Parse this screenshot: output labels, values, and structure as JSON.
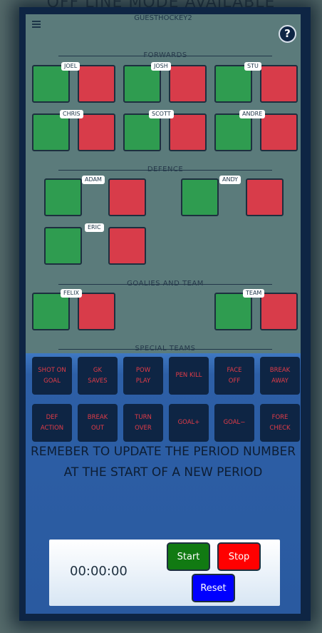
{
  "banner": "OFF LINE MODE AVAILABLE",
  "header": {
    "title": "GUESTHOCKEY2",
    "help_label": "?"
  },
  "sections": {
    "forwards": "FORWARDS",
    "defence": "DEFENCE",
    "goalies_team": "GOALIES AND TEAM",
    "special_teams": "SPECIAL TEAMS"
  },
  "players": {
    "forwards": [
      "JOEL",
      "JOSH",
      "STU",
      "CHRIS",
      "SCOTT",
      "ANDRE"
    ],
    "defence": [
      "ADAM",
      "ANDY",
      "ERIC"
    ],
    "goalies_team": [
      "FELIX",
      "TEAM"
    ]
  },
  "special_teams": [
    "SHOT ON\nGOAL",
    "GK\nSAVES",
    "POW\nPLAY",
    "PEN KILL",
    "FACE\nOFF",
    "BREAK\nAWAY",
    "DEF\nACTION",
    "BREAK\nOUT",
    "TURN\nOVER",
    "GOAL+",
    "GOAL−",
    "FORE\nCHECK"
  ],
  "reminder": "REMEBER TO UPDATE THE PERIOD NUMBER AT THE START OF A NEW PERIOD",
  "timer": {
    "value": "00:00:00",
    "start_label": "Start",
    "stop_label": "Stop",
    "reset_label": "Reset"
  },
  "colors": {
    "green": "#2f9c50",
    "red": "#d83c4a",
    "navy": "#0e2544",
    "panel": "#5b7b7b"
  }
}
